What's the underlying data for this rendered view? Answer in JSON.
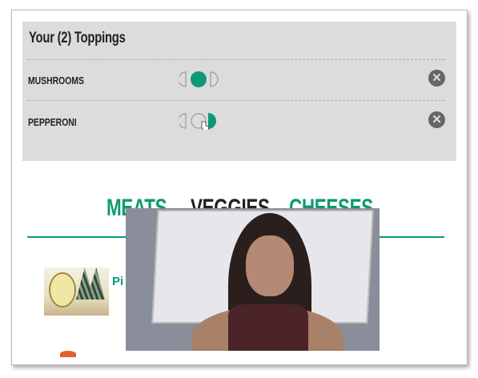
{
  "toppings_panel": {
    "title": "Your (2) Toppings",
    "items": [
      {
        "name": "MUSHROOMS",
        "portion": "whole",
        "remove_icon": "close-circle-icon"
      },
      {
        "name": "PEPPERONI",
        "portion": "right-half",
        "remove_icon": "close-circle-icon"
      }
    ]
  },
  "tabs": [
    {
      "label": "MEATS",
      "color": "#0c9a72"
    },
    {
      "label": "VEGGIES",
      "color": "#222222",
      "active": true
    },
    {
      "label": "CHEESES",
      "color": "#0c9a72"
    }
  ],
  "products": [
    {
      "name": "Pi"
    }
  ],
  "colors": {
    "accent": "#0c9a72",
    "panel": "#dcdcdc"
  },
  "remove_glyph": "✕"
}
